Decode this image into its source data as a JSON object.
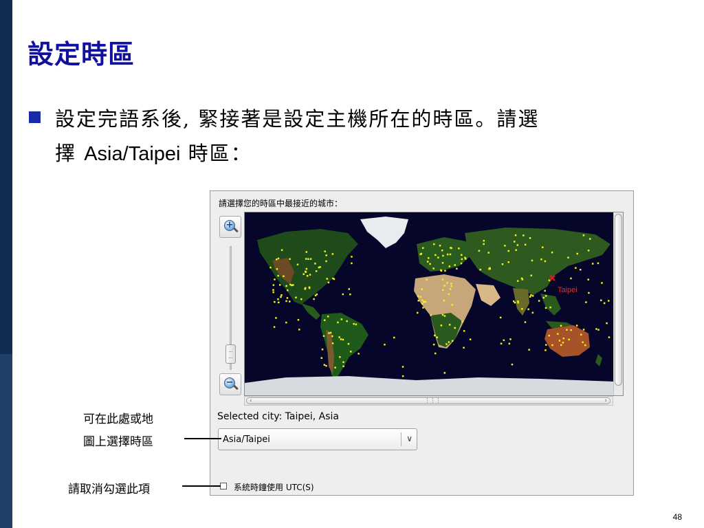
{
  "slide": {
    "title": "設定時區",
    "bullet_line1": "設定完語系後, 緊接著是設定主機所在的時區。請選",
    "bullet_line2_a": "擇 ",
    "bullet_line2_b": "Asia/Taipei",
    "bullet_line2_c": " 時區：",
    "page_number": "48"
  },
  "dialog": {
    "prompt": "請選擇您的時區中最接近的城市：",
    "selected_city": "Selected city: Taipei, Asia",
    "timezone_value": "Asia/Taipei",
    "map_city_label": "Taipei",
    "utc_label": "系統時鐘使用 UTC(S)"
  },
  "annotations": {
    "note1_line1": "可在此處或地",
    "note1_line2": "圖上選擇時區",
    "note2": "請取消勾選此項"
  },
  "colors": {
    "title": "#1010a0",
    "ocean": "#06052a",
    "city_dot": "#f0f020",
    "selected_marker": "#e02020"
  },
  "icons": {
    "zoom_in": "zoom-in-icon",
    "zoom_out": "zoom-out-icon",
    "dropdown": "chevron-down-icon"
  }
}
